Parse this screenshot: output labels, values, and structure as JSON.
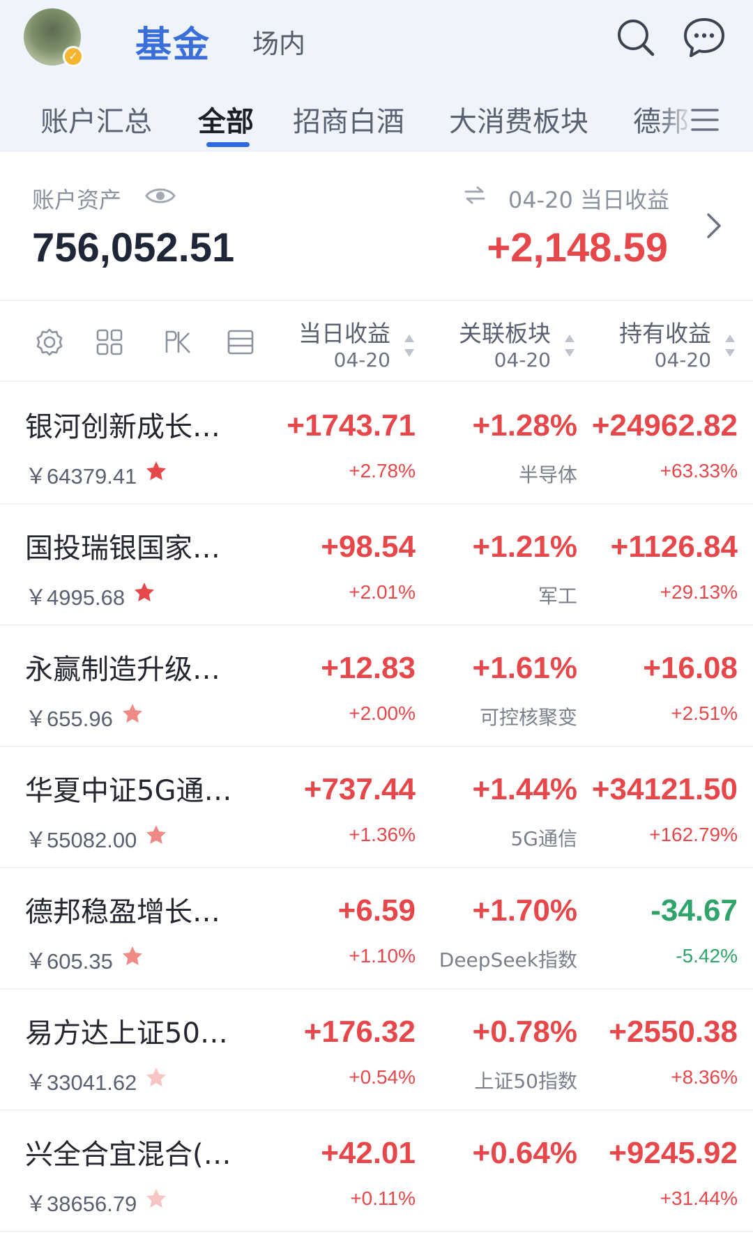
{
  "header": {
    "title": "基金",
    "subtitle": "场内",
    "tabs": [
      {
        "label": "账户汇总"
      },
      {
        "label": "全部"
      },
      {
        "label": "招商白酒"
      },
      {
        "label": "大消费板块"
      },
      {
        "label": "德邦"
      }
    ],
    "active_tab": "全部",
    "icons": [
      "search-icon",
      "message-icon",
      "menu-icon"
    ]
  },
  "summary": {
    "assets_label": "账户资产",
    "assets_value": "756,052.51",
    "daily_label": "04-20 当日收益",
    "daily_value": "+2,148.59"
  },
  "columns": {
    "icons": [
      "settings-icon",
      "grid-icon",
      "chart-k-icon",
      "list-icon"
    ],
    "c1": {
      "title": "当日收益",
      "date": "04-20"
    },
    "c2": {
      "title": "关联板块",
      "date": "04-20"
    },
    "c3": {
      "title": "持有收益",
      "date": "04-20"
    }
  },
  "funds": [
    {
      "name": "银河创新成长…",
      "amount": "￥64379.41",
      "star": "full",
      "daily": "+1743.71",
      "daily_pct": "+2.78%",
      "sector_change": "+1.28%",
      "sector": "半导体",
      "hold": "+24962.82",
      "hold_pct": "+63.33%"
    },
    {
      "name": "国投瑞银国家…",
      "amount": "￥4995.68",
      "star": "full",
      "daily": "+98.54",
      "daily_pct": "+2.01%",
      "sector_change": "+1.21%",
      "sector": "军工",
      "hold": "+1126.84",
      "hold_pct": "+29.13%"
    },
    {
      "name": "永赢制造升级…",
      "amount": "￥655.96",
      "star": "mid",
      "daily": "+12.83",
      "daily_pct": "+2.00%",
      "sector_change": "+1.61%",
      "sector": "可控核聚变",
      "hold": "+16.08",
      "hold_pct": "+2.51%"
    },
    {
      "name": "华夏中证5G通…",
      "amount": "￥55082.00",
      "star": "mid",
      "daily": "+737.44",
      "daily_pct": "+1.36%",
      "sector_change": "+1.44%",
      "sector": "5G通信",
      "hold": "+34121.50",
      "hold_pct": "+162.79%"
    },
    {
      "name": "德邦稳盈增长…",
      "amount": "￥605.35",
      "star": "mid",
      "daily": "+6.59",
      "daily_pct": "+1.10%",
      "sector_change": "+1.70%",
      "sector": "DeepSeek指数",
      "hold": "-34.67",
      "hold_pct": "-5.42%"
    },
    {
      "name": "易方达上证50…",
      "amount": "￥33041.62",
      "star": "light",
      "daily": "+176.32",
      "daily_pct": "+0.54%",
      "sector_change": "+0.78%",
      "sector": "上证50指数",
      "hold": "+2550.38",
      "hold_pct": "+8.36%"
    },
    {
      "name": "兴全合宜混合(…",
      "amount": "￥38656.79",
      "star": "light",
      "daily": "+42.01",
      "daily_pct": "+0.11%",
      "sector_change": "+0.64%",
      "sector": "",
      "hold": "+9245.92",
      "hold_pct": "+31.44%"
    }
  ],
  "colors": {
    "accent": "#2e68e0",
    "up": "#e5474a",
    "down": "#2fa36a"
  }
}
